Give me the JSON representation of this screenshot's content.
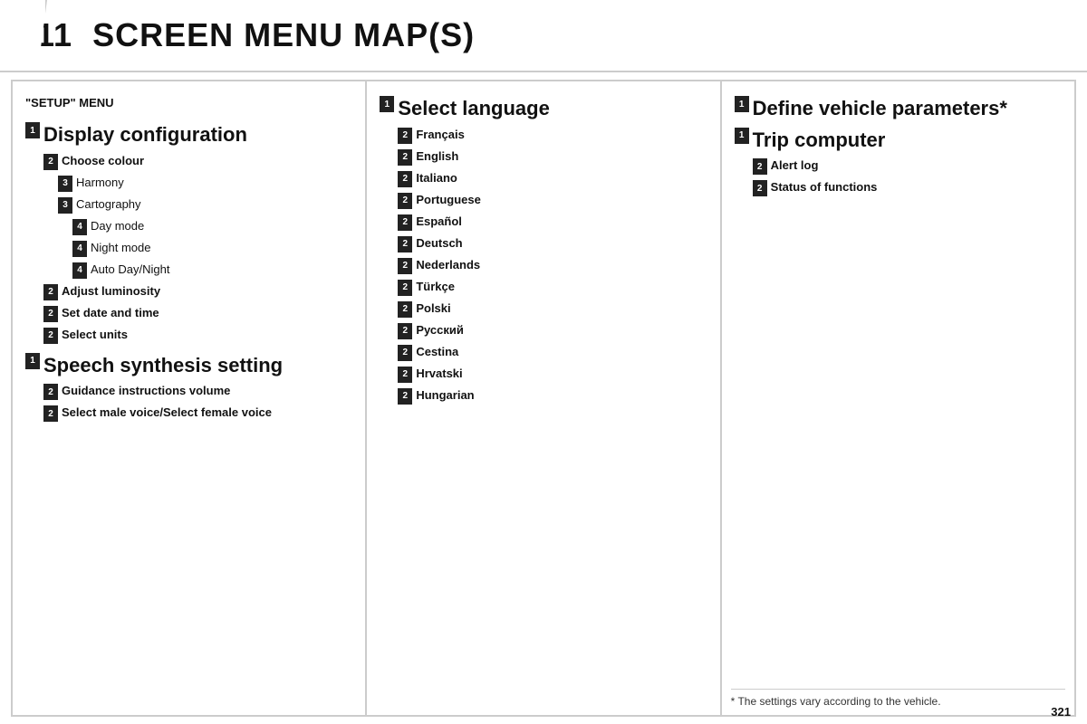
{
  "header": {
    "chapter": "11",
    "title": "SCREEN MENU MAP(S)"
  },
  "col1": {
    "setup_label": "\"SETUP\" MENU",
    "sections": [
      {
        "badge": "1",
        "text": "Display configuration",
        "size": "large",
        "indent": "indent-0",
        "children": [
          {
            "badge": "2",
            "text": "Choose colour",
            "size": "bold",
            "indent": "indent-1",
            "children": [
              {
                "badge": "3",
                "text": "Harmony",
                "size": "normal",
                "indent": "indent-2"
              },
              {
                "badge": "3",
                "text": "Cartography",
                "size": "normal",
                "indent": "indent-2"
              },
              {
                "badge": "4",
                "text": "Day mode",
                "size": "normal",
                "indent": "indent-3"
              },
              {
                "badge": "4",
                "text": "Night mode",
                "size": "normal",
                "indent": "indent-3"
              },
              {
                "badge": "4",
                "text": "Auto Day/Night",
                "size": "normal",
                "indent": "indent-3"
              }
            ]
          },
          {
            "badge": "2",
            "text": "Adjust luminosity",
            "size": "bold",
            "indent": "indent-1"
          },
          {
            "badge": "2",
            "text": "Set date and time",
            "size": "bold",
            "indent": "indent-1"
          },
          {
            "badge": "2",
            "text": "Select units",
            "size": "bold",
            "indent": "indent-1"
          }
        ]
      },
      {
        "badge": "1",
        "text": "Speech synthesis setting",
        "size": "large",
        "indent": "indent-0",
        "children": [
          {
            "badge": "2",
            "text": "Guidance instructions volume",
            "size": "bold",
            "indent": "indent-1"
          },
          {
            "badge": "2",
            "text": "Select male voice/Select female voice",
            "size": "bold",
            "indent": "indent-1"
          }
        ]
      }
    ]
  },
  "col2": {
    "title": "Select language",
    "badge": "1",
    "languages": [
      {
        "badge": "2",
        "text": "Français"
      },
      {
        "badge": "2",
        "text": "English"
      },
      {
        "badge": "2",
        "text": "Italiano"
      },
      {
        "badge": "2",
        "text": "Portuguese"
      },
      {
        "badge": "2",
        "text": "Español"
      },
      {
        "badge": "2",
        "text": "Deutsch"
      },
      {
        "badge": "2",
        "text": "Nederlands"
      },
      {
        "badge": "2",
        "text": "Türkçe"
      },
      {
        "badge": "2",
        "text": "Polski"
      },
      {
        "badge": "2",
        "text": "Русский"
      },
      {
        "badge": "2",
        "text": "Cestina"
      },
      {
        "badge": "2",
        "text": "Hrvatski"
      },
      {
        "badge": "2",
        "text": "Hungarian"
      }
    ]
  },
  "col3": {
    "items": [
      {
        "badge": "1",
        "text": "Define vehicle parameters*",
        "size": "large"
      },
      {
        "badge": "1",
        "text": "Trip computer",
        "size": "large"
      },
      {
        "badge": "2",
        "text": "Alert log",
        "size": "bold",
        "indent": "indent-1"
      },
      {
        "badge": "2",
        "text": "Status of functions",
        "size": "bold",
        "indent": "indent-1"
      }
    ],
    "footer_note": "* The settings vary according to the vehicle."
  },
  "page_number": "321"
}
